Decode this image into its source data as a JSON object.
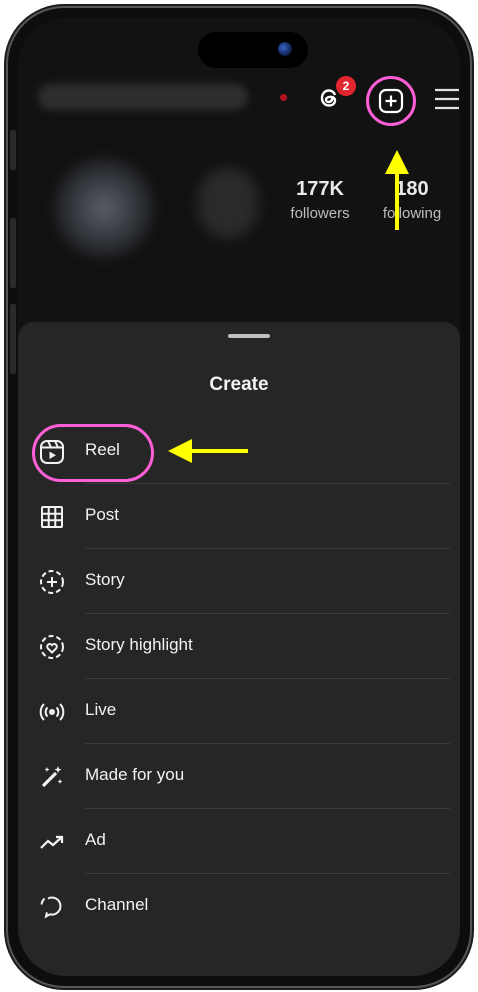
{
  "header": {
    "threads_badge": "2"
  },
  "stats": {
    "followers": {
      "value": "177K",
      "label": "followers"
    },
    "following": {
      "value": "180",
      "label": "following"
    }
  },
  "sheet": {
    "title": "Create",
    "items": [
      {
        "label": "Reel",
        "icon": "reel-icon"
      },
      {
        "label": "Post",
        "icon": "grid-icon"
      },
      {
        "label": "Story",
        "icon": "story-add-icon"
      },
      {
        "label": "Story highlight",
        "icon": "highlight-icon"
      },
      {
        "label": "Live",
        "icon": "live-icon"
      },
      {
        "label": "Made for you",
        "icon": "magic-wand-icon"
      },
      {
        "label": "Ad",
        "icon": "trend-icon"
      },
      {
        "label": "Channel",
        "icon": "channel-icon"
      }
    ]
  },
  "colors": {
    "annotation_circle": "#ff5fd6",
    "annotation_arrow": "#ffff00",
    "sheet_bg": "#262626",
    "badge": "#e0262f"
  }
}
